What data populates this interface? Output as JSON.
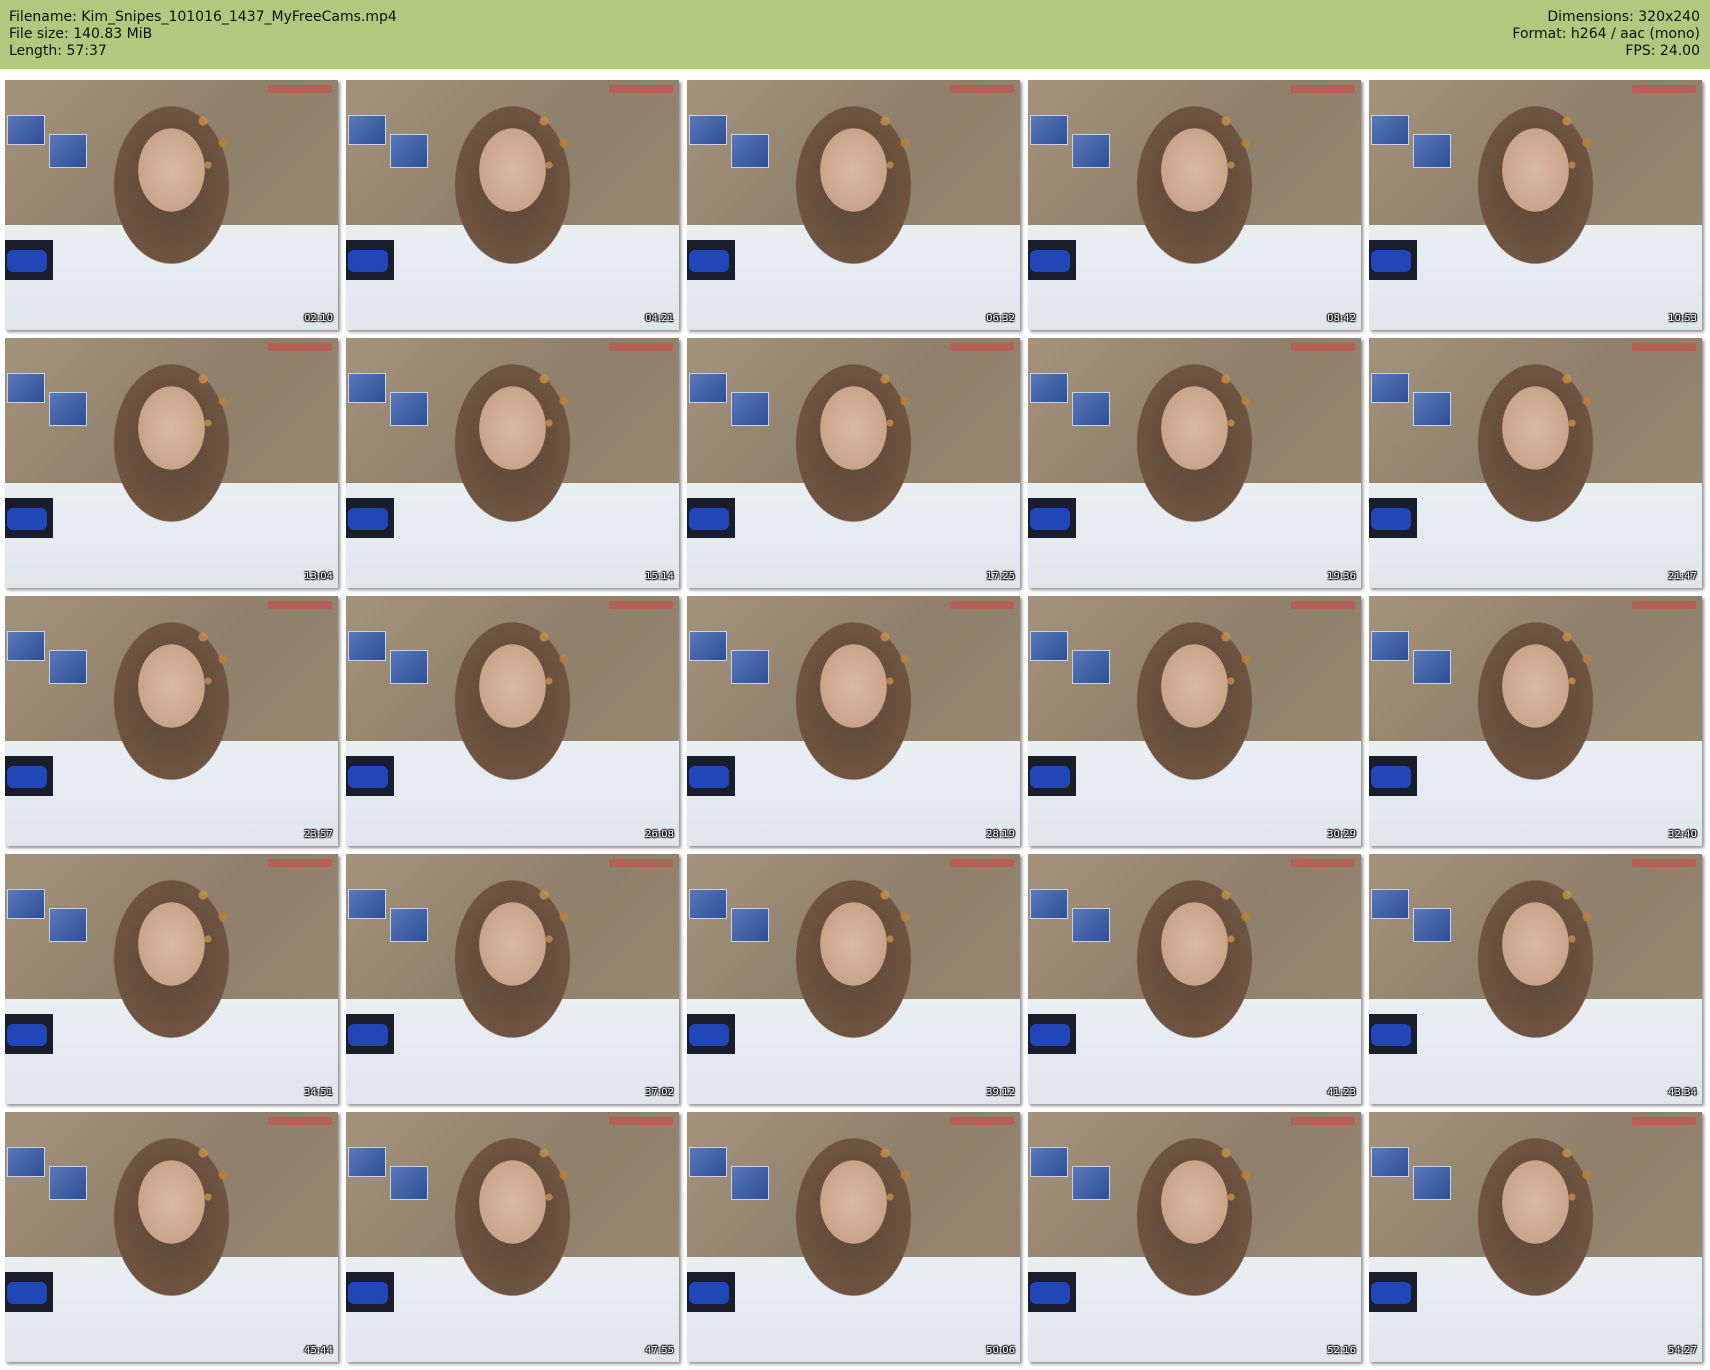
{
  "header": {
    "left": [
      "Filename: Kim_Snipes_101016_1437_MyFreeCams.mp4",
      "File size: 140.83 MiB",
      "Length: 57:37"
    ],
    "right": [
      "Dimensions: 320x240",
      "Format: h264 / aac (mono)",
      "FPS: 24.00"
    ],
    "background": "#b0c97f"
  },
  "thumbnails": [
    {
      "timestamp": "02:10"
    },
    {
      "timestamp": "04:21"
    },
    {
      "timestamp": "06:32"
    },
    {
      "timestamp": "08:42"
    },
    {
      "timestamp": "10:53"
    },
    {
      "timestamp": "13:04"
    },
    {
      "timestamp": "15:14"
    },
    {
      "timestamp": "17:25"
    },
    {
      "timestamp": "19:36"
    },
    {
      "timestamp": "21:47"
    },
    {
      "timestamp": "23:57"
    },
    {
      "timestamp": "26:08"
    },
    {
      "timestamp": "28:19"
    },
    {
      "timestamp": "30:29"
    },
    {
      "timestamp": "32:40"
    },
    {
      "timestamp": "34:51"
    },
    {
      "timestamp": "37:02"
    },
    {
      "timestamp": "39:12"
    },
    {
      "timestamp": "41:23"
    },
    {
      "timestamp": "43:34"
    },
    {
      "timestamp": "45:44"
    },
    {
      "timestamp": "47:55"
    },
    {
      "timestamp": "50:06"
    },
    {
      "timestamp": "52:16"
    },
    {
      "timestamp": "54:27"
    }
  ]
}
